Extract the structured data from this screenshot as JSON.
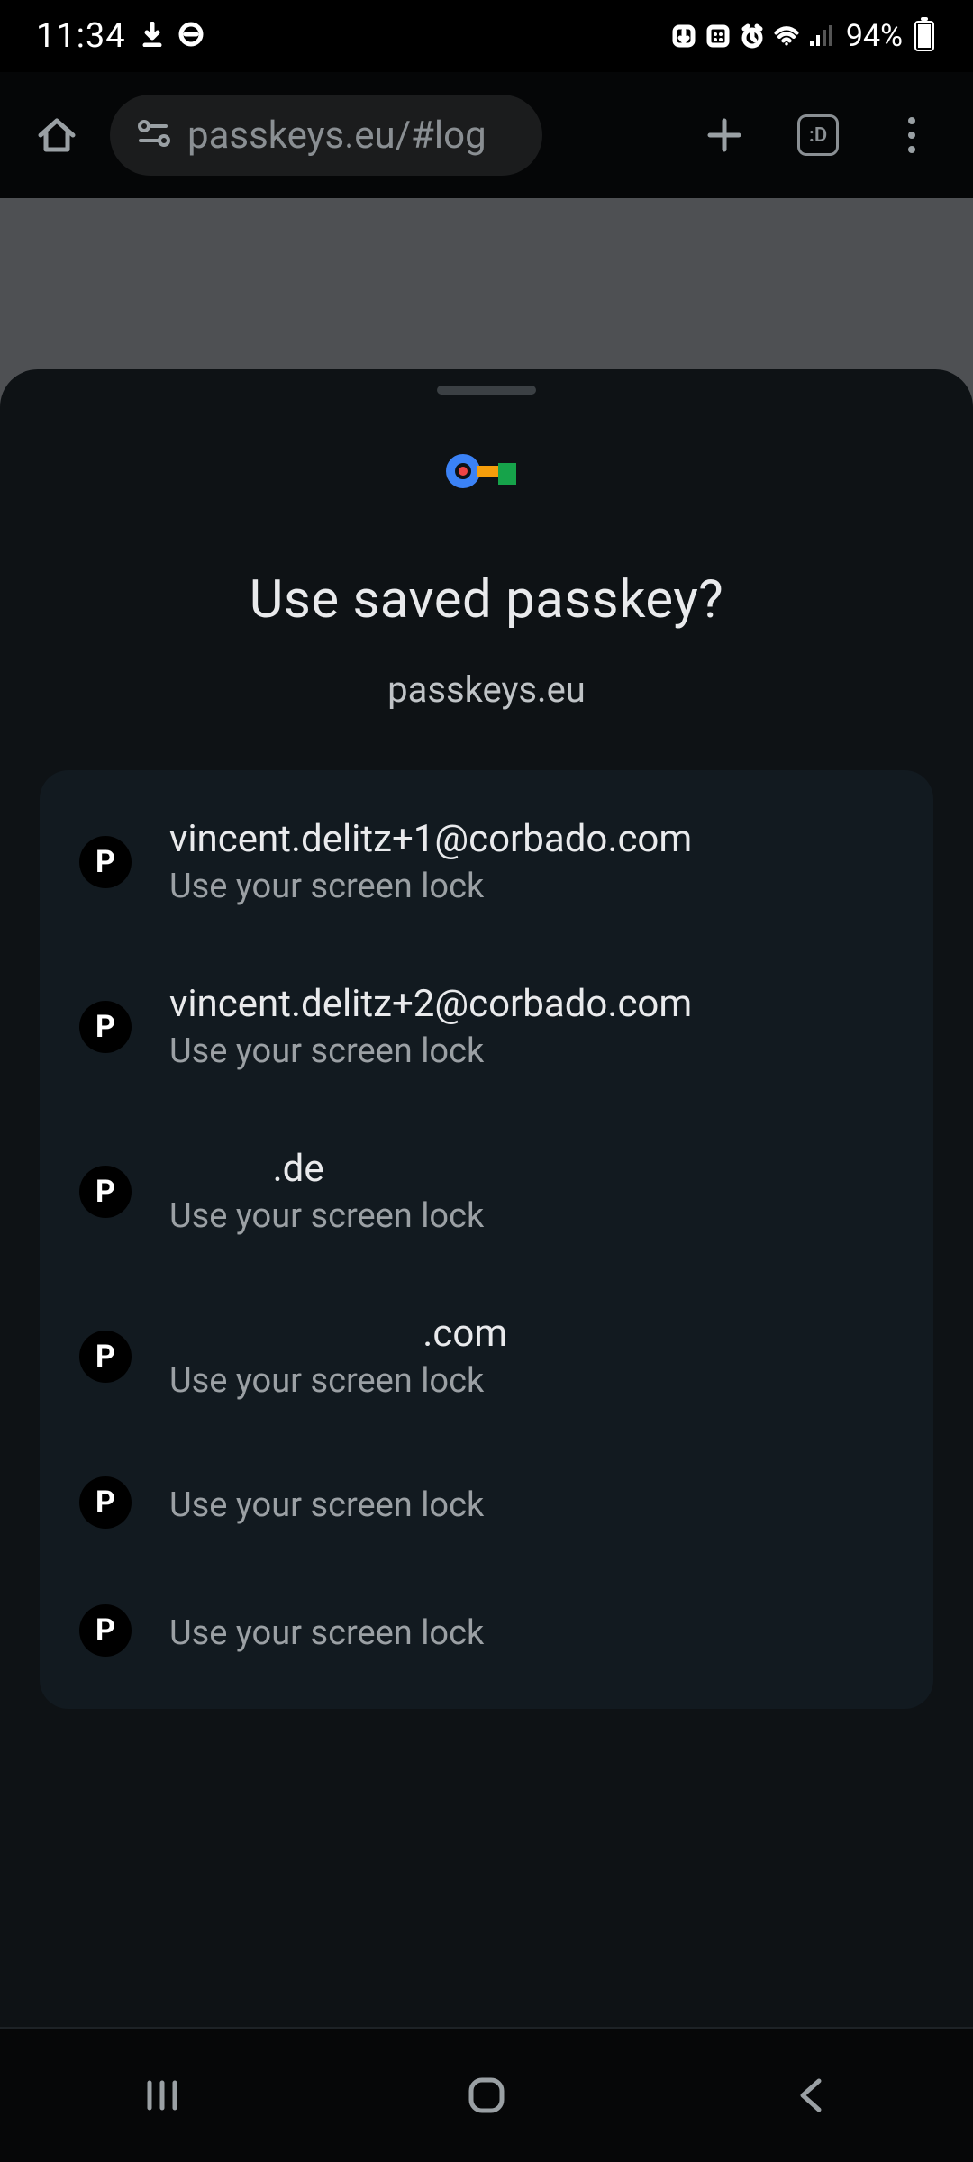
{
  "status": {
    "time": "11:34",
    "battery_percent": "94%"
  },
  "browser": {
    "url_display": "passkeys.eu/#log",
    "tabs_indicator": ":D"
  },
  "sheet": {
    "title": "Use saved passkey?",
    "domain": "passkeys.eu",
    "item_icon_letter": "P",
    "subtitle": "Use your screen lock",
    "items": [
      {
        "email": "vincent.delitz+1@corbado.com"
      },
      {
        "email": "vincent.delitz+2@corbado.com"
      },
      {
        "email": "           .de"
      },
      {
        "email": "                           .com"
      },
      {
        "email": ""
      },
      {
        "email": ""
      }
    ]
  }
}
